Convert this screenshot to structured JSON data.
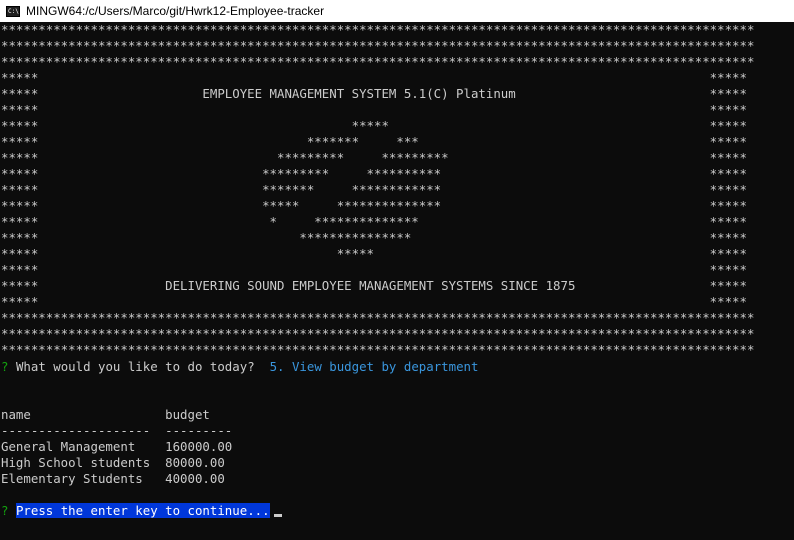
{
  "window": {
    "title": "MINGW64:/c/Users/Marco/git/Hwrk12-Employee-tracker",
    "icon": "terminal-icon"
  },
  "banner": [
    "*****************************************************************************************************",
    "*****************************************************************************************************",
    "*****************************************************************************************************",
    "*****                                                                                          *****",
    "*****                      EMPLOYEE MANAGEMENT SYSTEM 5.1(C) Platinum                          *****",
    "*****                                                                                          *****",
    "*****                                          *****                                           *****",
    "*****                                    *******     ***                                       *****",
    "*****                                *********     *********                                   *****",
    "*****                              *********     **********                                    *****",
    "*****                              *******     ************                                    *****",
    "*****                              *****     **************                                    *****",
    "*****                               *     **************                                       *****",
    "*****                                   ***************                                        *****",
    "*****                                        *****                                             *****",
    "*****                                                                                          *****",
    "*****                 DELIVERING SOUND EMPLOYEE MANAGEMENT SYSTEMS SINCE 1875                  *****",
    "*****                                                                                          *****",
    "*****************************************************************************************************",
    "*****************************************************************************************************",
    "*****************************************************************************************************"
  ],
  "prompt": {
    "marker": "?",
    "question": "What would you like to do today?",
    "answer": "5. View budget by department"
  },
  "table": {
    "header": "name                  budget",
    "separator": "--------------------  ---------",
    "rows": [
      "General Management    160000.00",
      "High School students  80000.00",
      "Elementary Students   40000.00"
    ]
  },
  "continue_prompt": {
    "marker": "?",
    "text": "Press the enter key to continue..."
  }
}
